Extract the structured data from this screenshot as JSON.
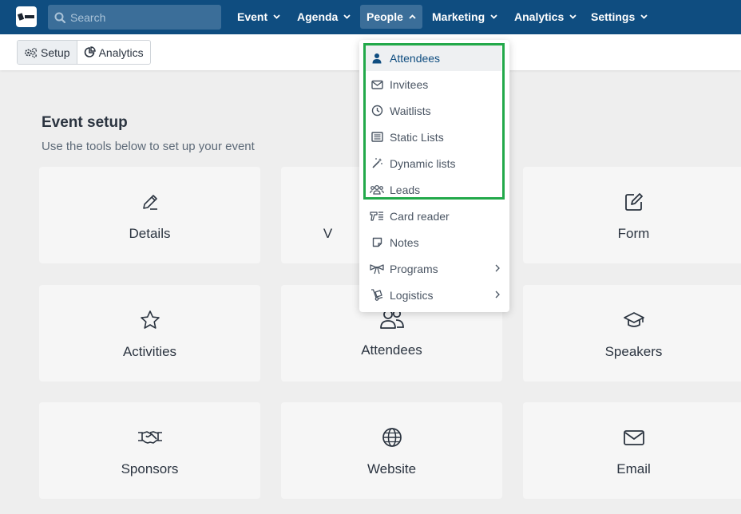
{
  "topbar": {
    "search_placeholder": "Search",
    "nav": [
      {
        "label": "Event"
      },
      {
        "label": "Agenda"
      },
      {
        "label": "People"
      },
      {
        "label": "Marketing"
      },
      {
        "label": "Analytics"
      },
      {
        "label": "Settings"
      }
    ],
    "active_nav": "People"
  },
  "subbar": {
    "tabs": [
      {
        "label": "Setup",
        "icon": "gears-icon"
      },
      {
        "label": "Analytics",
        "icon": "pie-chart-icon"
      }
    ],
    "active_tab": "Setup"
  },
  "main": {
    "title": "Event setup",
    "subtitle": "Use the tools below to set up your event",
    "cards": [
      {
        "label": "Details",
        "icon": "pencil-icon"
      },
      {
        "label": "V",
        "icon": "hidden-icon"
      },
      {
        "label": "Form",
        "icon": "edit-square-icon"
      },
      {
        "label": "Activities",
        "icon": "star-icon"
      },
      {
        "label": "Attendees",
        "icon": "users-icon"
      },
      {
        "label": "Speakers",
        "icon": "graduation-cap-icon"
      },
      {
        "label": "Sponsors",
        "icon": "handshake-icon"
      },
      {
        "label": "Website",
        "icon": "globe-icon"
      },
      {
        "label": "Email",
        "icon": "envelope-icon"
      }
    ]
  },
  "people_menu": {
    "items": [
      {
        "label": "Attendees",
        "icon": "user-icon"
      },
      {
        "label": "Invitees",
        "icon": "envelope-icon"
      },
      {
        "label": "Waitlists",
        "icon": "clock-icon"
      },
      {
        "label": "Static Lists",
        "icon": "list-icon"
      },
      {
        "label": "Dynamic lists",
        "icon": "magic-wand-icon"
      },
      {
        "label": "Leads",
        "icon": "users-group-icon"
      },
      {
        "label": "Card reader",
        "icon": "card-reader-icon"
      },
      {
        "label": "Notes",
        "icon": "note-icon"
      },
      {
        "label": "Programs",
        "icon": "ribbon-icon"
      },
      {
        "label": "Logistics",
        "icon": "dolly-icon"
      }
    ],
    "selected": "Attendees",
    "highlight_color": "#22a94a"
  },
  "colors": {
    "nav_bg": "#0f4d80",
    "nav_active_bg": "#3b6e99",
    "page_bg": "#eeeeee",
    "card_bg": "#f6f6f6",
    "accent": "#0f4d80"
  }
}
